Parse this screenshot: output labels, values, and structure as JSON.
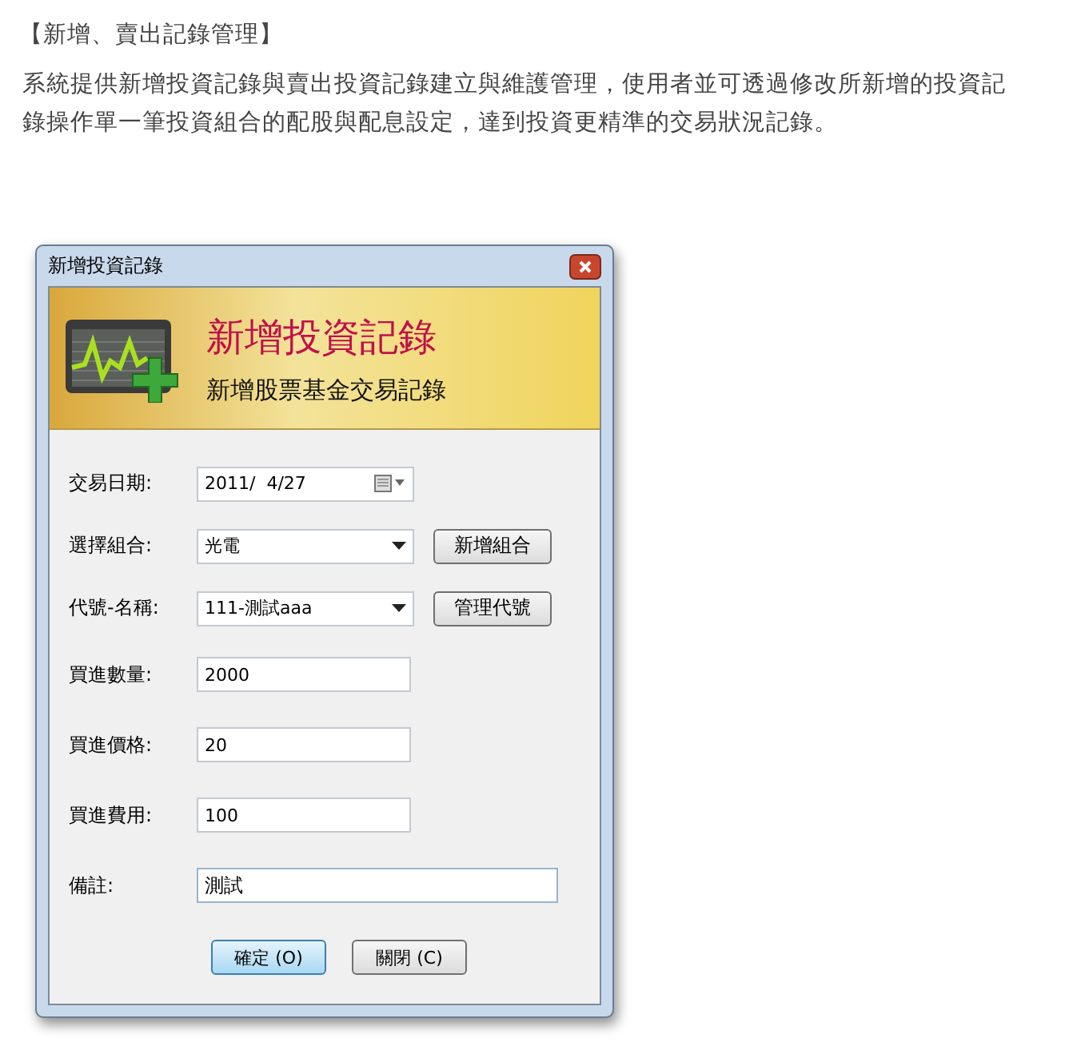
{
  "heading": "【新增、賣出記錄管理】",
  "intro": "系統提供新增投資記錄與賣出投資記錄建立與維護管理，使用者並可透過修改所新增的投資記錄操作單一筆投資組合的配股與配息設定，達到投資更精準的交易狀況記錄。",
  "dialog": {
    "title": "新增投資記錄",
    "banner": {
      "title": "新增投資記錄",
      "subtitle": "新增股票基金交易記錄"
    },
    "fields": [
      {
        "label": "交易日期:",
        "kind": "date",
        "value": "2011/  4/27"
      },
      {
        "label": "選擇組合:",
        "kind": "combo",
        "value": "光電",
        "button": "新增組合"
      },
      {
        "label": "代號-名稱:",
        "kind": "combo",
        "value": "111-測試aaa",
        "button": "管理代號"
      },
      {
        "label": "買進數量:",
        "kind": "text",
        "value": "2000"
      },
      {
        "label": "買進價格:",
        "kind": "text",
        "value": "20"
      },
      {
        "label": "買進費用:",
        "kind": "text",
        "value": "100"
      },
      {
        "label": "備註:",
        "kind": "wide",
        "value": "測試"
      }
    ],
    "buttons": [
      {
        "label": "確定 (O)",
        "default": true
      },
      {
        "label": "關閉 (C)",
        "default": false
      }
    ]
  }
}
